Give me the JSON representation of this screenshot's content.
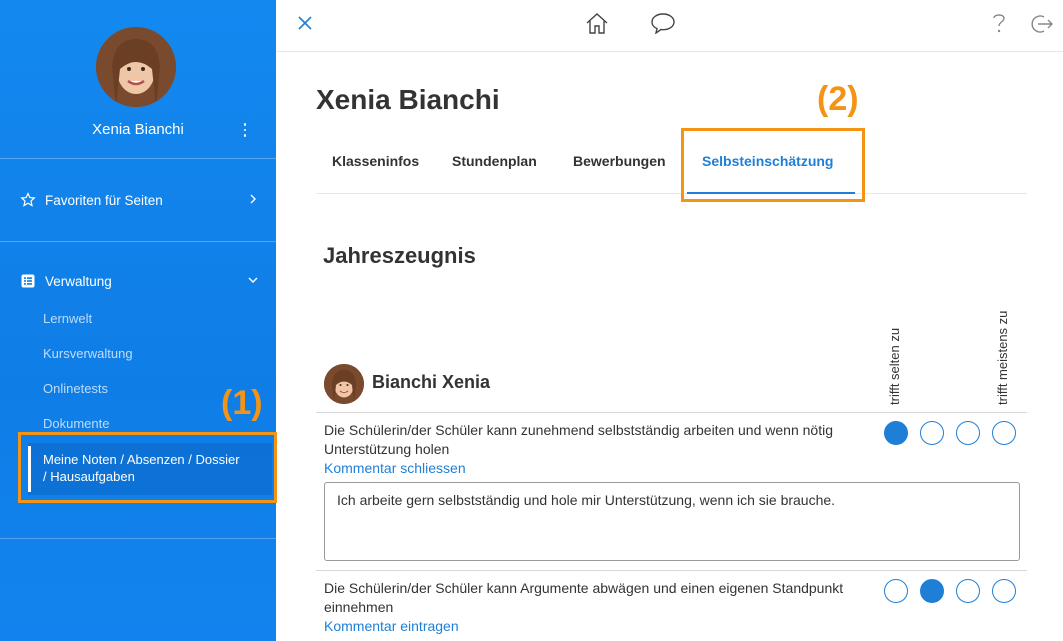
{
  "sidebar": {
    "profile_name": "Xenia Bianchi",
    "favorites_label": "Favoriten für Seiten",
    "admin_label": "Verwaltung",
    "sub_items": [
      "Lernwelt",
      "Kursverwaltung",
      "Onlinetests",
      "Dokumente"
    ],
    "active_item": "Meine Noten / Absenzen / Dossier / Hausaufgaben"
  },
  "annotations": {
    "label_1": "(1)",
    "label_2": "(2)"
  },
  "page": {
    "title": "Xenia Bianchi"
  },
  "tabs": [
    {
      "label": "Klasseninfos"
    },
    {
      "label": "Stundenplan"
    },
    {
      "label": "Bewerbungen"
    },
    {
      "label": "Selbsteinschätzung",
      "active": true
    }
  ],
  "assessment": {
    "section_title": "Jahreszeugnis",
    "scale_low": "trifft selten zu",
    "scale_high": "trifft meistens zu",
    "student_name": "Bianchi Xenia",
    "items": [
      {
        "statement": "Die Schülerin/der Schüler kann zunehmend selbstständig arbeiten und wenn nötig Unterstützung holen",
        "link": "Kommentar schliessen",
        "comment": "Ich arbeite gern selbstständig und hole mir Unterstützung, wenn ich sie brauche.",
        "selected": 1
      },
      {
        "statement": "Die Schülerin/der Schüler kann Argumente abwägen und einen eigenen Standpunkt einnehmen",
        "link": "Kommentar eintragen",
        "selected": 2
      }
    ]
  },
  "colors": {
    "accent": "#1f7fd6",
    "sidebar": "#0f7de6",
    "highlight": "#f39416"
  }
}
